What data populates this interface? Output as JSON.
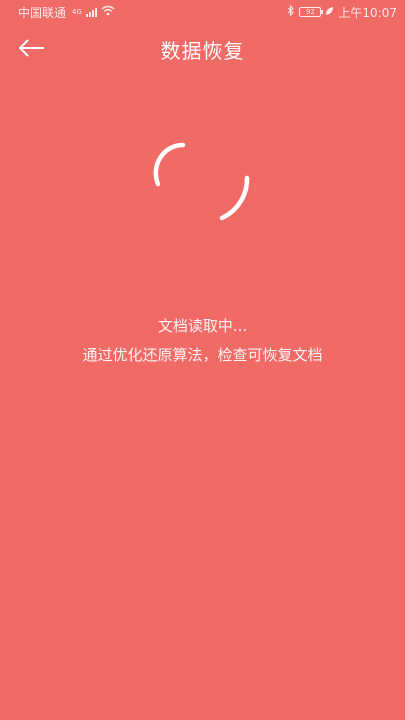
{
  "status_bar": {
    "carrier": "中国联通",
    "network_type": "4G",
    "battery": "92",
    "time": "上午10:07"
  },
  "header": {
    "title": "数据恢复"
  },
  "loading": {
    "status_text": "文档读取中...",
    "description": "通过优化还原算法，检查可恢复文档"
  },
  "colors": {
    "background": "#F06A66",
    "foreground": "#FFFFFF"
  },
  "icons": {
    "back": "arrow-left-icon",
    "spinner": "loading-spinner-icon"
  }
}
